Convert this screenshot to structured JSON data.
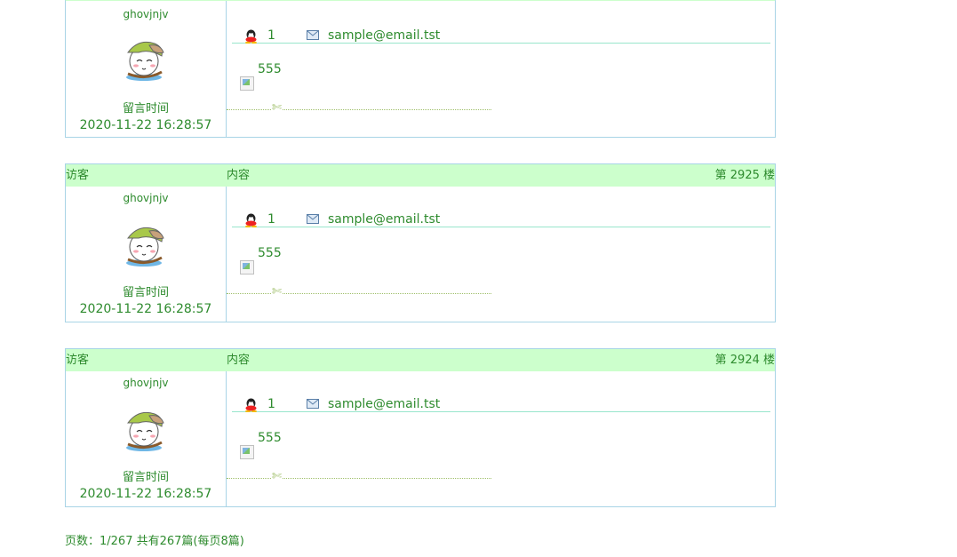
{
  "posts": [
    {
      "floor": null,
      "header_visitor": null,
      "header_content": null,
      "username": "ghovjnjv",
      "qq": "1",
      "email": "sample@email.tst",
      "message": "555",
      "time_label": "留言时间",
      "time": "2020-11-22 16:28:57"
    },
    {
      "floor": "第 2925 楼",
      "header_visitor": "访客",
      "header_content": "内容",
      "username": "ghovjnjv",
      "qq": "1",
      "email": "sample@email.tst",
      "message": "555",
      "time_label": "留言时间",
      "time": "2020-11-22 16:28:57"
    },
    {
      "floor": "第 2924 楼",
      "header_visitor": "访客",
      "header_content": "内容",
      "username": "ghovjnjv",
      "qq": "1",
      "email": "sample@email.tst",
      "message": "555",
      "time_label": "留言时间",
      "time": "2020-11-22 16:28:57"
    }
  ],
  "icons": {
    "qq": "qq-penguin-icon",
    "mail": "envelope-icon",
    "scissors": "scissors-icon",
    "avatar": "cartoon-avatar"
  },
  "pager": {
    "text": "页数：1/267 共有267篇(每页8篇)"
  },
  "colors": {
    "text": "#2e8b2e",
    "header_bg": "#ccffcc",
    "border": "#a8d4e6"
  }
}
